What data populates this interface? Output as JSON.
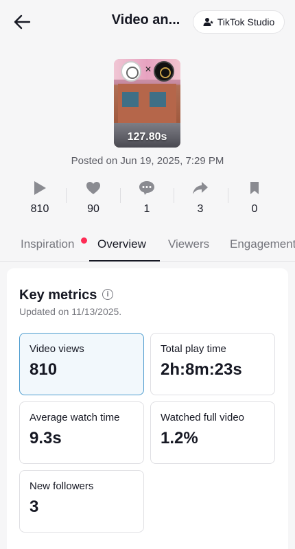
{
  "header": {
    "title": "Video an...",
    "studio_label": "TikTok Studio",
    "back_icon": "arrow-left-icon",
    "studio_icon": "person-star-icon"
  },
  "video": {
    "duration": "127.80s",
    "posted": "Posted on Jun 19, 2025, 7:29 PM"
  },
  "stats": [
    {
      "icon": "play-icon",
      "value": "810"
    },
    {
      "icon": "heart-icon",
      "value": "90"
    },
    {
      "icon": "comment-icon",
      "value": "1"
    },
    {
      "icon": "share-icon",
      "value": "3"
    },
    {
      "icon": "bookmark-icon",
      "value": "0"
    }
  ],
  "tabs": [
    {
      "label": "Inspiration",
      "has_dot": true
    },
    {
      "label": "Overview",
      "active": true
    },
    {
      "label": "Viewers"
    },
    {
      "label": "Engagement"
    }
  ],
  "key_metrics": {
    "title": "Key metrics",
    "updated": "Updated on 11/13/2025.",
    "metrics": [
      {
        "label": "Video views",
        "value": "810",
        "selected": true
      },
      {
        "label": "Total play time",
        "value": "2h:8m:23s"
      },
      {
        "label": "Average watch time",
        "value": "9.3s"
      },
      {
        "label": "Watched full video",
        "value": "1.2%"
      },
      {
        "label": "New followers",
        "value": "3"
      }
    ]
  },
  "colors": {
    "accent_dot": "#fe2c55",
    "selected_border": "#4d9ccf",
    "icon_gray": "#8a8b91"
  }
}
